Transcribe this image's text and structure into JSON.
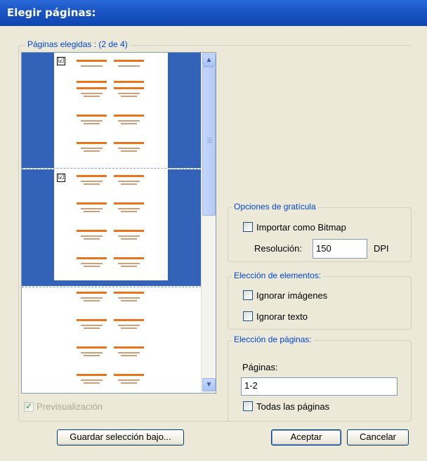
{
  "window": {
    "title": "Elegir páginas:"
  },
  "preview_group": {
    "legend": "Páginas elegidas : (2 de 4)"
  },
  "pages": [
    {
      "selected": true,
      "checked": true,
      "check_mark": "☑"
    },
    {
      "selected": true,
      "checked": true,
      "check_mark": "☑"
    },
    {
      "selected": false,
      "checked": false,
      "check_mark": ""
    }
  ],
  "preview_checkbox": {
    "label": "Previsualización",
    "checked": true,
    "disabled": true
  },
  "grid_options": {
    "legend": "Opciones de gratícula",
    "import_bitmap_label": "Importar como Bitmap",
    "import_bitmap_checked": false,
    "resolution_label": "Resolución:",
    "resolution_value": "150",
    "resolution_unit": "DPI"
  },
  "element_options": {
    "legend": "Elección de elementos:",
    "ignore_images_label": "Ignorar imágenes",
    "ignore_text_label": "Ignorar texto"
  },
  "page_options": {
    "legend": "Elección de páginas:",
    "pages_label": "Páginas:",
    "pages_value": "1-2",
    "all_pages_label": "Todas las páginas"
  },
  "buttons": {
    "save_selection": "Guardar selección bajo...",
    "accept": "Aceptar",
    "cancel": "Cancelar"
  },
  "colors": {
    "selection": "#3263b8",
    "accent": "#e8741c",
    "title_bar": "#1b56c4"
  },
  "icons": {
    "scroll_up": "chevron-up-icon",
    "scroll_down": "chevron-down-icon"
  }
}
